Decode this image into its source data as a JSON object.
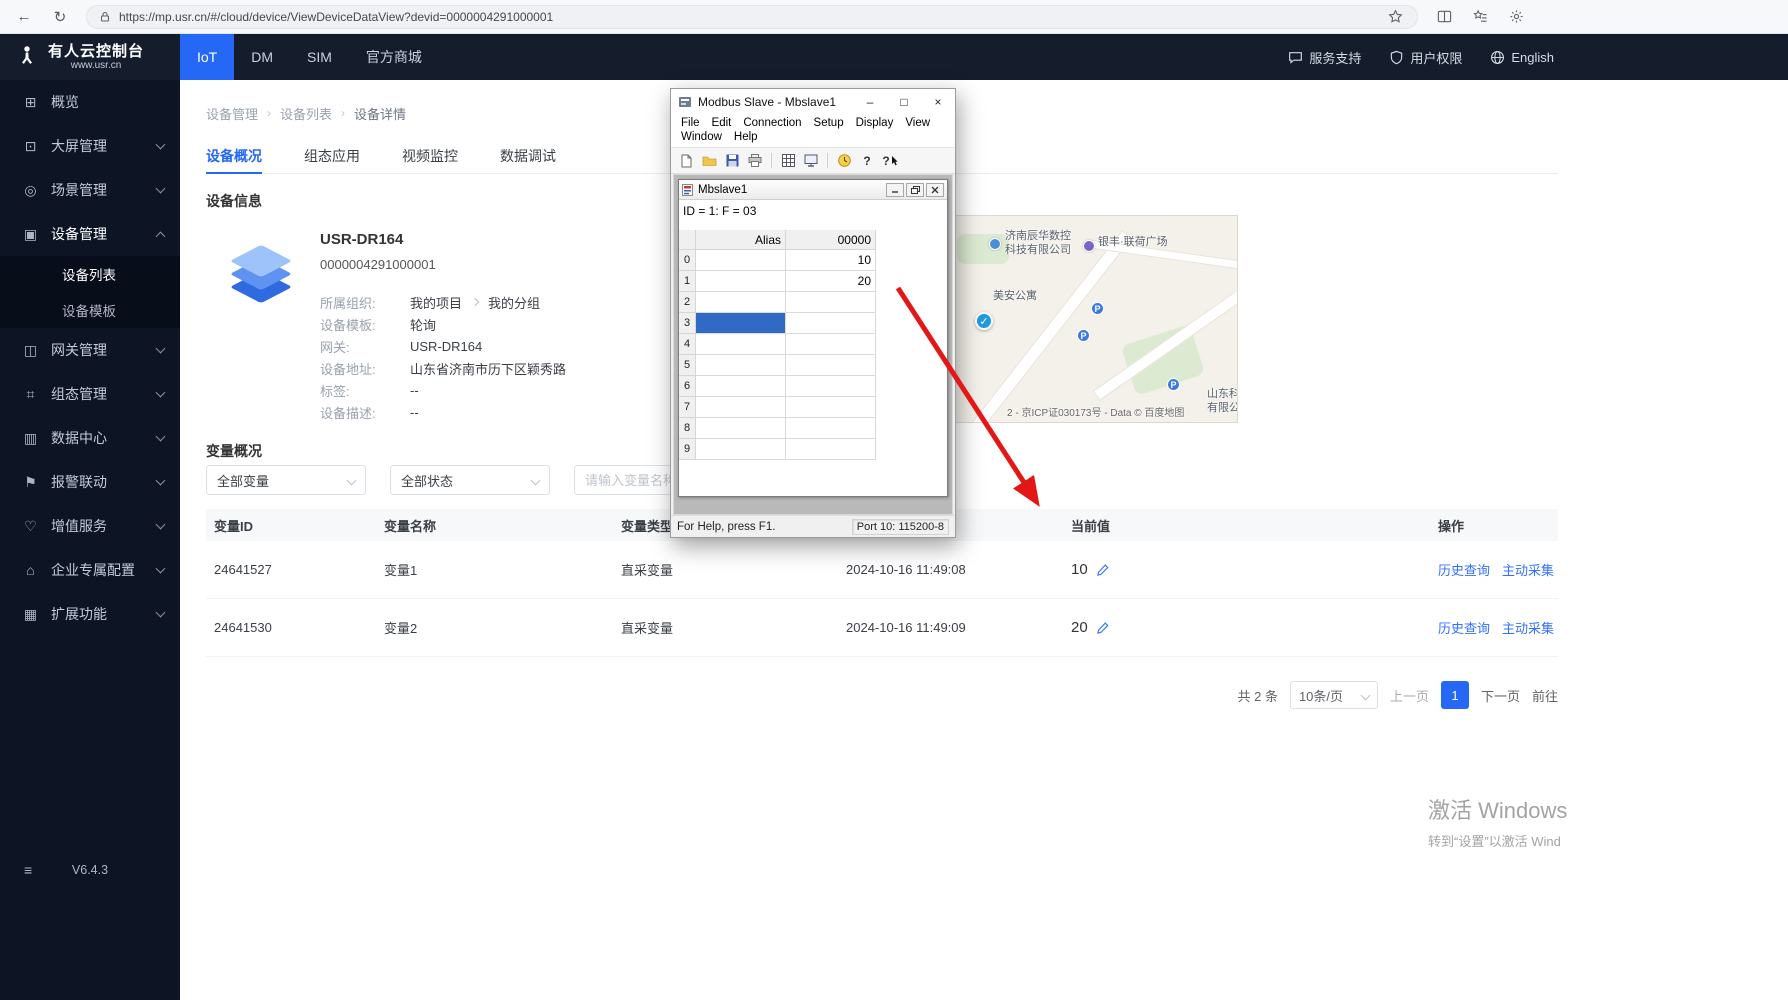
{
  "browser": {
    "url": "https://mp.usr.cn/#/cloud/device/ViewDeviceDataView?devid=0000004291000001"
  },
  "topbar": {
    "logo_title": "有人云控制台",
    "logo_subtitle": "www.usr.cn",
    "tabs": [
      {
        "label": "IoT"
      },
      {
        "label": "DM"
      },
      {
        "label": "SIM"
      },
      {
        "label": "官方商城"
      }
    ],
    "right": {
      "support": "服务支持",
      "permissions": "用户权限",
      "language": "English"
    }
  },
  "sidebar": {
    "icons": {
      "overview": "⊞",
      "screen": "⊡",
      "scene": "◎",
      "device": "▣",
      "gateway": "◫",
      "config": "⌗",
      "data": "▥",
      "alarm": "⚑",
      "vas": "♡",
      "enterprise": "⌂",
      "extension": "▦",
      "collapse": "≡"
    },
    "items": [
      {
        "label": "概览"
      },
      {
        "label": "大屏管理"
      },
      {
        "label": "场景管理"
      },
      {
        "label": "设备管理"
      },
      {
        "label": "设备列表"
      },
      {
        "label": "设备模板"
      },
      {
        "label": "网关管理"
      },
      {
        "label": "组态管理"
      },
      {
        "label": "数据中心"
      },
      {
        "label": "报警联动"
      },
      {
        "label": "增值服务"
      },
      {
        "label": "企业专属配置"
      },
      {
        "label": "扩展功能"
      }
    ],
    "version": "V6.4.3"
  },
  "breadcrumb": {
    "items": [
      "设备管理",
      "设备列表",
      "设备详情"
    ]
  },
  "content_tabs": [
    {
      "label": "设备概况"
    },
    {
      "label": "组态应用"
    },
    {
      "label": "视频监控"
    },
    {
      "label": "数据调试"
    }
  ],
  "device": {
    "section_title": "设备信息",
    "name": "USR-DR164",
    "id": "0000004291000001",
    "org_label": "所属组织:",
    "org_project": "我的项目",
    "org_group": "我的分组",
    "fields": [
      {
        "label": "设备模板:",
        "value": "轮询"
      },
      {
        "label": "网关:",
        "value": "USR-DR164"
      },
      {
        "label": "设备地址:",
        "value": "山东省济南市历下区颖秀路"
      },
      {
        "label": "标签:",
        "value": "--"
      },
      {
        "label": "设备描述:",
        "value": "--"
      }
    ]
  },
  "map": {
    "poi1a": "济南辰华数控",
    "poi1b": "科技有限公司",
    "poi2": "银丰·联荷广场",
    "poi3": "美安公寓",
    "poi4a": "山东科",
    "poi4b": "有限公",
    "parking": "P",
    "check": "✓",
    "copyright": "2 - 京ICP证030173号 - Data © 百度地图"
  },
  "variables": {
    "section_title": "变量概况",
    "filter_variable": "全部变量",
    "filter_status": "全部状态",
    "search_placeholder": "请输入变量名称",
    "headers": {
      "id": "变量ID",
      "name": "变量名称",
      "type": "变量类型",
      "time": "",
      "value": "当前值",
      "actions": "操作"
    },
    "rows": [
      {
        "id": "24641527",
        "name": "变量1",
        "type": "直采变量",
        "time": "2024-10-16 11:49:08",
        "value": "10",
        "action1": "历史查询",
        "action2": "主动采集"
      },
      {
        "id": "24641530",
        "name": "变量2",
        "type": "直采变量",
        "time": "2024-10-16 11:49:09",
        "value": "20",
        "action1": "历史查询",
        "action2": "主动采集"
      }
    ],
    "pagination": {
      "total": "共 2 条",
      "page_size": "10条/页",
      "prev": "上一页",
      "page": "1",
      "next": "下一页",
      "goto": "前往"
    }
  },
  "modbus": {
    "title": "Modbus Slave - Mbslave1",
    "buttons": {
      "minimize": "–",
      "maximize": "□",
      "close": "×"
    },
    "menu_row1": [
      "File",
      "Edit",
      "Connection",
      "Setup",
      "Display",
      "View"
    ],
    "menu_row2": [
      "Window",
      "Help"
    ],
    "help_icon": "?",
    "child_title": "Mbslave1",
    "id_line": "ID = 1: F = 03",
    "col_alias": "Alias",
    "col_value": "00000",
    "rows": [
      {
        "n": "0",
        "value": "10"
      },
      {
        "n": "1",
        "value": "20"
      },
      {
        "n": "2",
        "value": ""
      },
      {
        "n": "3",
        "value": ""
      },
      {
        "n": "4",
        "value": ""
      },
      {
        "n": "5",
        "value": ""
      },
      {
        "n": "6",
        "value": ""
      },
      {
        "n": "7",
        "value": ""
      },
      {
        "n": "8",
        "value": ""
      },
      {
        "n": "9",
        "value": ""
      }
    ],
    "status_left": "For Help, press F1.",
    "status_right": "Port 10: 115200-8"
  },
  "watermark": {
    "line1": "激活 Windows",
    "line2": "转到“设置”以激活 Wind"
  }
}
